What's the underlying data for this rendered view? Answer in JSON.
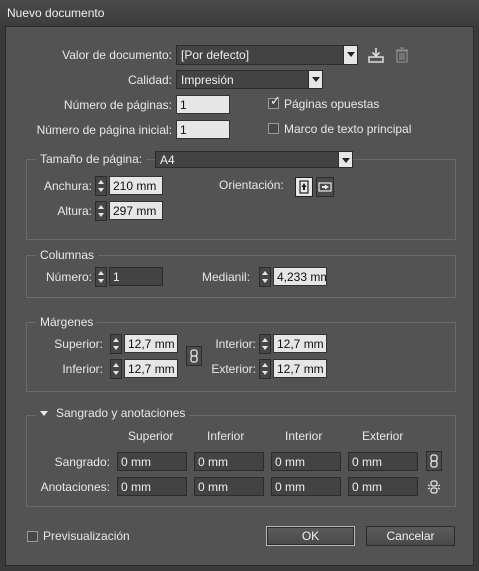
{
  "window": {
    "title": "Nuevo documento"
  },
  "document": {
    "preset_label": "Valor de documento:",
    "preset_value": "[Por defecto]",
    "quality_label": "Calidad:",
    "quality_value": "Impresión",
    "pages_label": "Número de páginas:",
    "pages_value": "1",
    "start_page_label": "Número de página inicial:",
    "start_page_value": "1",
    "facing_pages_label": "Páginas opuestas",
    "facing_pages_checked": true,
    "primary_text_frame_label": "Marco de texto principal",
    "primary_text_frame_checked": false
  },
  "page_size": {
    "legend": "Tamaño de página:",
    "value": "A4",
    "width_label": "Anchura:",
    "width_value": "210 mm",
    "height_label": "Altura:",
    "height_value": "297 mm",
    "orientation_label": "Orientación:",
    "orientation_selected": "portrait"
  },
  "columns": {
    "legend": "Columnas",
    "number_label": "Número:",
    "number_value": "1",
    "gutter_label": "Medianil:",
    "gutter_value": "4,233 mm"
  },
  "margins": {
    "legend": "Márgenes",
    "top_label": "Superior:",
    "top_value": "12,7 mm",
    "bottom_label": "Inferior:",
    "bottom_value": "12,7 mm",
    "inside_label": "Interior:",
    "inside_value": "12,7 mm",
    "outside_label": "Exterior:",
    "outside_value": "12,7 mm"
  },
  "bleed": {
    "legend": "Sangrado y anotaciones",
    "col_top": "Superior",
    "col_bottom": "Inferior",
    "col_inside": "Interior",
    "col_outside": "Exterior",
    "bleed_label": "Sangrado:",
    "bleed_values": [
      "0 mm",
      "0 mm",
      "0 mm",
      "0 mm"
    ],
    "slug_label": "Anotaciones:",
    "slug_values": [
      "0 mm",
      "0 mm",
      "0 mm",
      "0 mm"
    ]
  },
  "footer": {
    "preview_label": "Previsualización",
    "preview_checked": false,
    "ok_label": "OK",
    "cancel_label": "Cancelar"
  }
}
